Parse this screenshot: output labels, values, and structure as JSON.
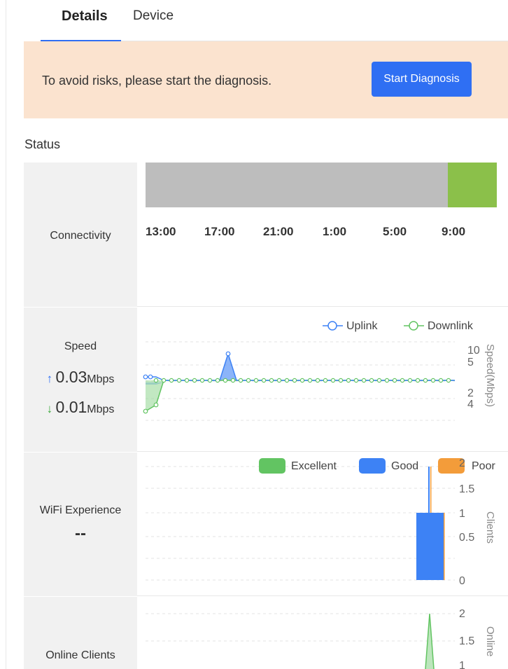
{
  "tabs": {
    "details": "Details",
    "device": "Device"
  },
  "banner": {
    "text": "To avoid risks, please start the diagnosis.",
    "button": "Start Diagnosis"
  },
  "status_title": "Status",
  "connectivity": {
    "label": "Connectivity",
    "times": [
      "13:00",
      "17:00",
      "21:00",
      "1:00",
      "5:00",
      "9:00"
    ]
  },
  "speed": {
    "label": "Speed",
    "up_arrow": "↑",
    "up_value": "0.03",
    "up_unit": "Mbps",
    "down_arrow": "↓",
    "down_value": "0.01",
    "down_unit": "Mbps",
    "legend_uplink": "Uplink",
    "legend_downlink": "Downlink",
    "axis_label": "Speed(Mbps)",
    "ticks_top": [
      "10",
      "5"
    ],
    "ticks_bottom": [
      "2",
      "4"
    ]
  },
  "wifi": {
    "label": "WiFi Experience",
    "value": "--",
    "legend": [
      "Excellent",
      "Good",
      "Poor"
    ],
    "axis_label": "Clients",
    "ticks": [
      "2",
      "1.5",
      "1",
      "0.5",
      "0"
    ]
  },
  "clients": {
    "label": "Online Clients",
    "axis_label": "Online",
    "ticks": [
      "2",
      "1.5",
      "1"
    ]
  },
  "colors": {
    "accent": "#2f6ff3",
    "excellent": "#62c462",
    "good": "#3d82f5",
    "poor": "#f39c3a",
    "gray_bar": "#bdbdbd"
  }
}
